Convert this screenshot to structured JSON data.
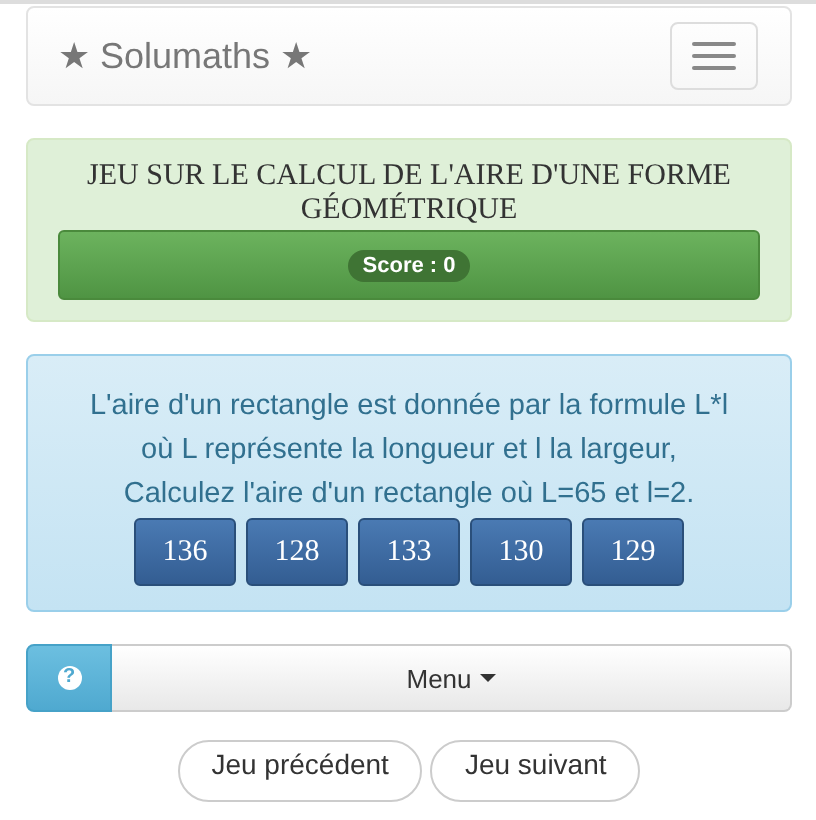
{
  "navbar": {
    "brand": "★ Solumaths ★"
  },
  "game": {
    "title": "JEU SUR LE CALCUL DE L'AIRE D'UNE FORME GÉOMÉTRIQUE",
    "score": "Score : 0"
  },
  "question": {
    "text": "L'aire d'un rectangle est donnée par la formule L*l où L représente la longueur et l la largeur, Calculez l'aire d'un rectangle où L=65 et l=2.",
    "answers": [
      "136",
      "128",
      "133",
      "130",
      "129"
    ]
  },
  "menu": {
    "help": "?",
    "label": "Menu"
  },
  "nav_buttons": [
    "Jeu précédent",
    "Jeu suivant"
  ]
}
